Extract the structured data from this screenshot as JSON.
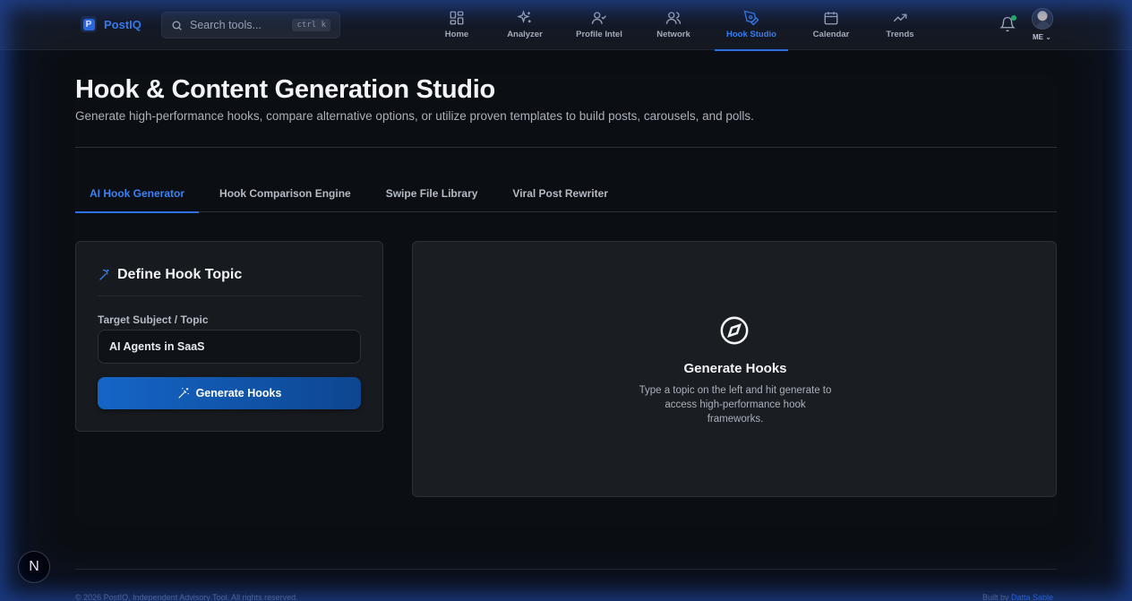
{
  "app": {
    "brand": "PostIQ"
  },
  "search": {
    "placeholder": "Search tools...",
    "shortcut": "ctrl k"
  },
  "nav": {
    "items": [
      {
        "label": "Home",
        "icon": "grid-icon"
      },
      {
        "label": "Analyzer",
        "icon": "sparkles-icon"
      },
      {
        "label": "Profile Intel",
        "icon": "user-check-icon"
      },
      {
        "label": "Network",
        "icon": "users-icon"
      },
      {
        "label": "Hook Studio",
        "icon": "pen-tool-icon",
        "active": true
      },
      {
        "label": "Calendar",
        "icon": "calendar-icon"
      },
      {
        "label": "Trends",
        "icon": "trending-up-icon"
      }
    ]
  },
  "user": {
    "label": "ME"
  },
  "page": {
    "title": "Hook & Content Generation Studio",
    "subtitle": "Generate high-performance hooks, compare alternative options, or utilize proven templates to build posts, carousels, and polls."
  },
  "tabs": [
    {
      "label": "AI Hook Generator",
      "active": true
    },
    {
      "label": "Hook Comparison Engine"
    },
    {
      "label": "Swipe File Library"
    },
    {
      "label": "Viral Post Rewriter"
    }
  ],
  "define_card": {
    "title": "Define Hook Topic",
    "field_label": "Target Subject / Topic",
    "field_value": "AI Agents in SaaS",
    "button_label": "Generate Hooks"
  },
  "empty_state": {
    "title": "Generate Hooks",
    "text": "Type a topic on the left and hit generate to access high-performance hook frameworks."
  },
  "footer": {
    "copyright": "© 2026 PostIQ. Independent Advisory Tool. All rights reserved.",
    "built_by_prefix": "Built by",
    "built_by_name": "Datta Sable"
  },
  "dev_badge": {
    "letter": "N"
  },
  "colors": {
    "accent": "#2f6fe8",
    "background": "#0b0e12",
    "card": "#171a1f",
    "status_dot": "#22c55e"
  }
}
